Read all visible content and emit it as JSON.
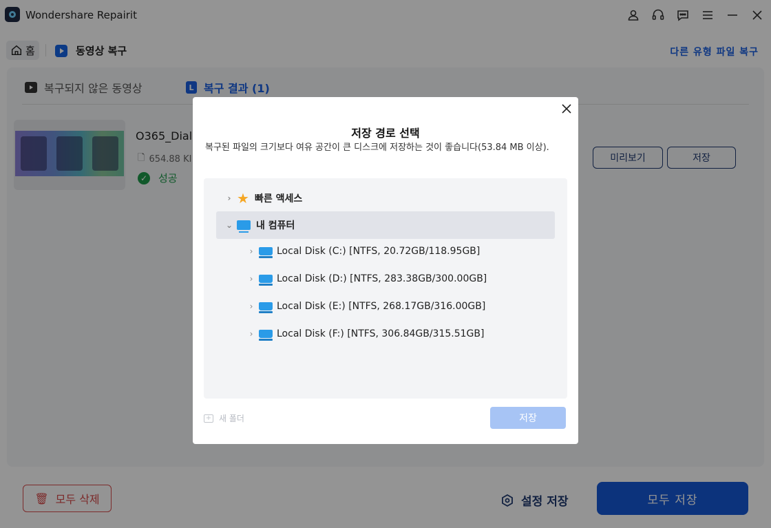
{
  "app": {
    "title": "Wondershare Repairit"
  },
  "window_icons": [
    "user-icon",
    "headset-icon",
    "chat-icon",
    "menu-icon",
    "minimize-icon",
    "close-icon"
  ],
  "nav": {
    "home_label": "홈",
    "crumb_label": "동영상 복구",
    "other_link": "다른 유형 파일 복구"
  },
  "tabs": [
    {
      "label": "복구되지 않은 동영상"
    },
    {
      "label": "복구 결과 (1)"
    }
  ],
  "file": {
    "name": "O365_Dialo",
    "size": "654.88 KI",
    "status": "성공",
    "preview_label": "미리보기",
    "save_label": "저장"
  },
  "footer": {
    "delete_all": "모두 삭제",
    "settings_save": "설정 저장",
    "save_all": "모두 저장"
  },
  "dialog": {
    "title": "저장 경로 선택",
    "description": "복구된 파일의 크기보다 여유 공간이 큰 디스크에 저장하는 것이 좋습니다(53.84 MB 이상).",
    "quick_access": "빠른 액세스",
    "my_computer": "내 컴퓨터",
    "disks": [
      {
        "label": "Local Disk (C:) [NTFS, 20.72GB/118.95GB]"
      },
      {
        "label": "Local Disk (D:) [NTFS, 283.38GB/300.00GB]"
      },
      {
        "label": "Local Disk (E:) [NTFS, 268.17GB/316.00GB]"
      },
      {
        "label": "Local Disk (F:) [NTFS, 306.84GB/315.51GB]"
      }
    ],
    "new_folder": "새 폴더",
    "save_button": "저장"
  },
  "colors": {
    "accent": "#1658d6",
    "success": "#1e9a4a",
    "danger": "#d64a4a",
    "disabled_button": "#a7c4f5"
  }
}
